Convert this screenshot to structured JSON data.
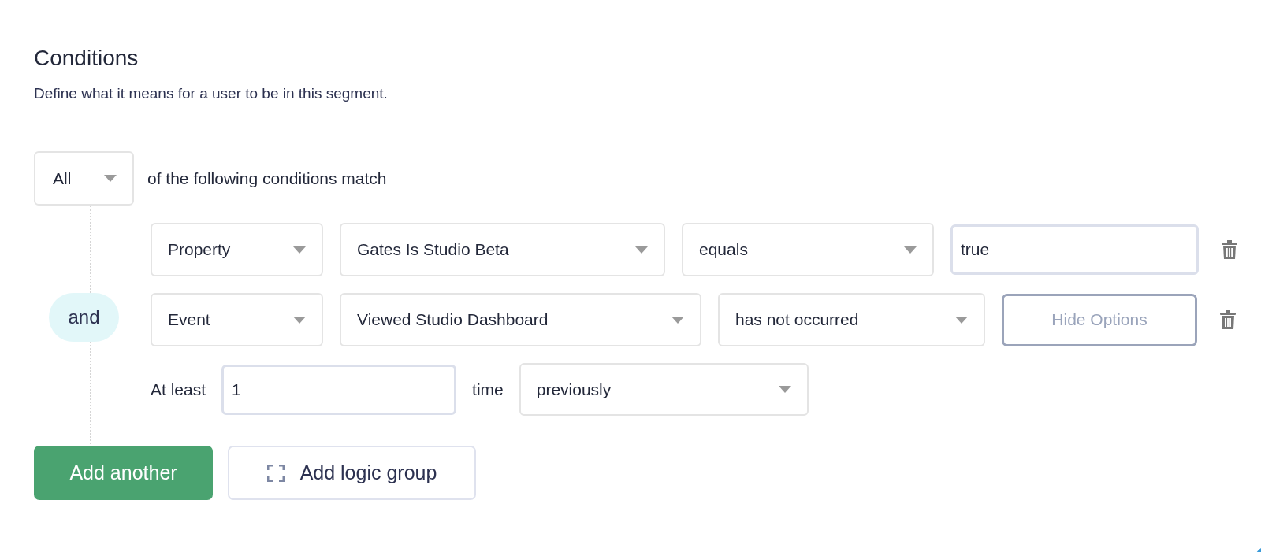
{
  "title": "Conditions",
  "subtitle": "Define what it means for a user to be in this segment.",
  "match": {
    "value": "All",
    "suffix": "of the following conditions match"
  },
  "connector": "and",
  "conditions": [
    {
      "fields": [
        {
          "kind": "dropdown",
          "value": "Property"
        },
        {
          "kind": "dropdown",
          "value": "Gates Is Studio Beta"
        },
        {
          "kind": "dropdown",
          "value": "equals"
        },
        {
          "kind": "input",
          "value": "true"
        }
      ]
    },
    {
      "fields": [
        {
          "kind": "dropdown",
          "value": "Event"
        },
        {
          "kind": "dropdown",
          "value": "Viewed Studio Dashboard"
        },
        {
          "kind": "dropdown",
          "value": "has not occurred"
        },
        {
          "kind": "button",
          "label": "Hide Options"
        }
      ]
    }
  ],
  "options": [
    {
      "kind": "label",
      "text": "At least"
    },
    {
      "kind": "input",
      "value": "1"
    },
    {
      "kind": "label",
      "text": "time"
    },
    {
      "kind": "dropdown",
      "value": "previously"
    }
  ],
  "buttons": [
    {
      "kind": "primary",
      "label": "Add another"
    },
    {
      "kind": "secondary",
      "label": "Add logic group"
    }
  ]
}
